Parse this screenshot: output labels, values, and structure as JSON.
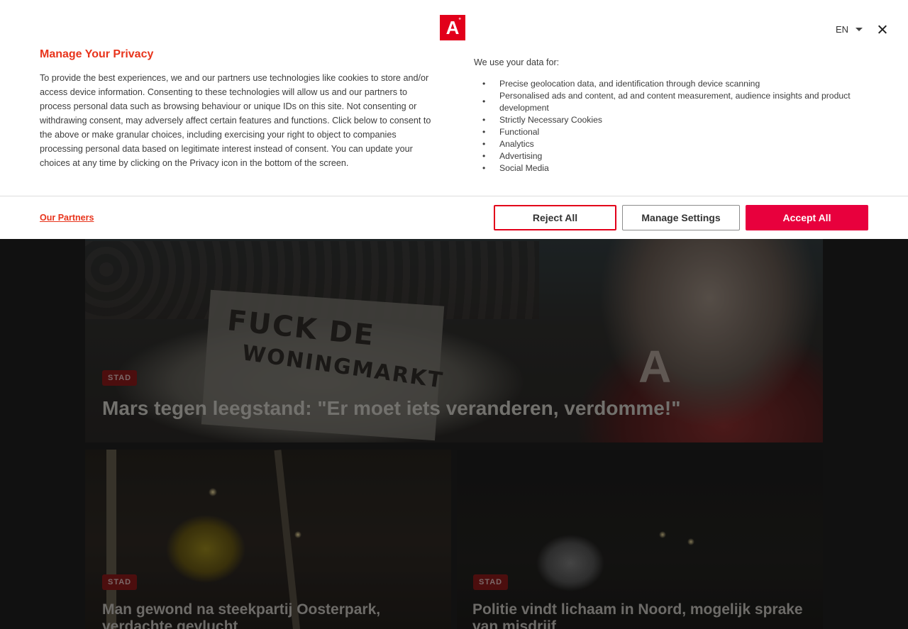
{
  "brand": {
    "logo_letter": "A",
    "logo_mark": "°",
    "color": "#e2001a"
  },
  "consent": {
    "language": "EN",
    "title": "Manage Your Privacy",
    "description": "To provide the best experiences, we and our partners use technologies like cookies to store and/or access device information. Consenting to these technologies will allow us and our partners to process personal data such as browsing behaviour or unique IDs on this site. Not consenting or withdrawing consent, may adversely affect certain features and functions. Click below to consent to the above or make granular choices, including exercising your right to object to companies processing personal data based on legitimate interest instead of consent. You can update your choices at any time by clicking on the Privacy icon in the bottom of the screen.",
    "use_title": "We use your data for:",
    "purposes": [
      "Precise geolocation data, and identification through device scanning",
      "Personalised ads and content, ad and content measurement, audience insights and product development",
      "Strictly Necessary Cookies",
      "Functional",
      "Analytics",
      "Advertising",
      "Social Media"
    ],
    "bullet": "•",
    "partners_link": "Our Partners",
    "buttons": {
      "reject": "Reject All",
      "manage": "Manage Settings",
      "accept": "Accept All"
    },
    "colors": {
      "title": "#e8341c",
      "accept": "#e8003d",
      "reject_border": "#e2001a"
    }
  },
  "news": {
    "hero": {
      "tag": "STAD",
      "title": "Mars tegen leegstand: \"Er moet iets veranderen, verdomme!\"",
      "banner_line1": "FUCK DE",
      "banner_line2": "WONINGMARKT"
    },
    "cards": [
      {
        "tag": "STAD",
        "title": "Man gewond na steekpartij Oosterpark, verdachte gevlucht"
      },
      {
        "tag": "STAD",
        "title": "Politie vindt lichaam in Noord, mogelijk sprake van misdrijf"
      }
    ]
  }
}
